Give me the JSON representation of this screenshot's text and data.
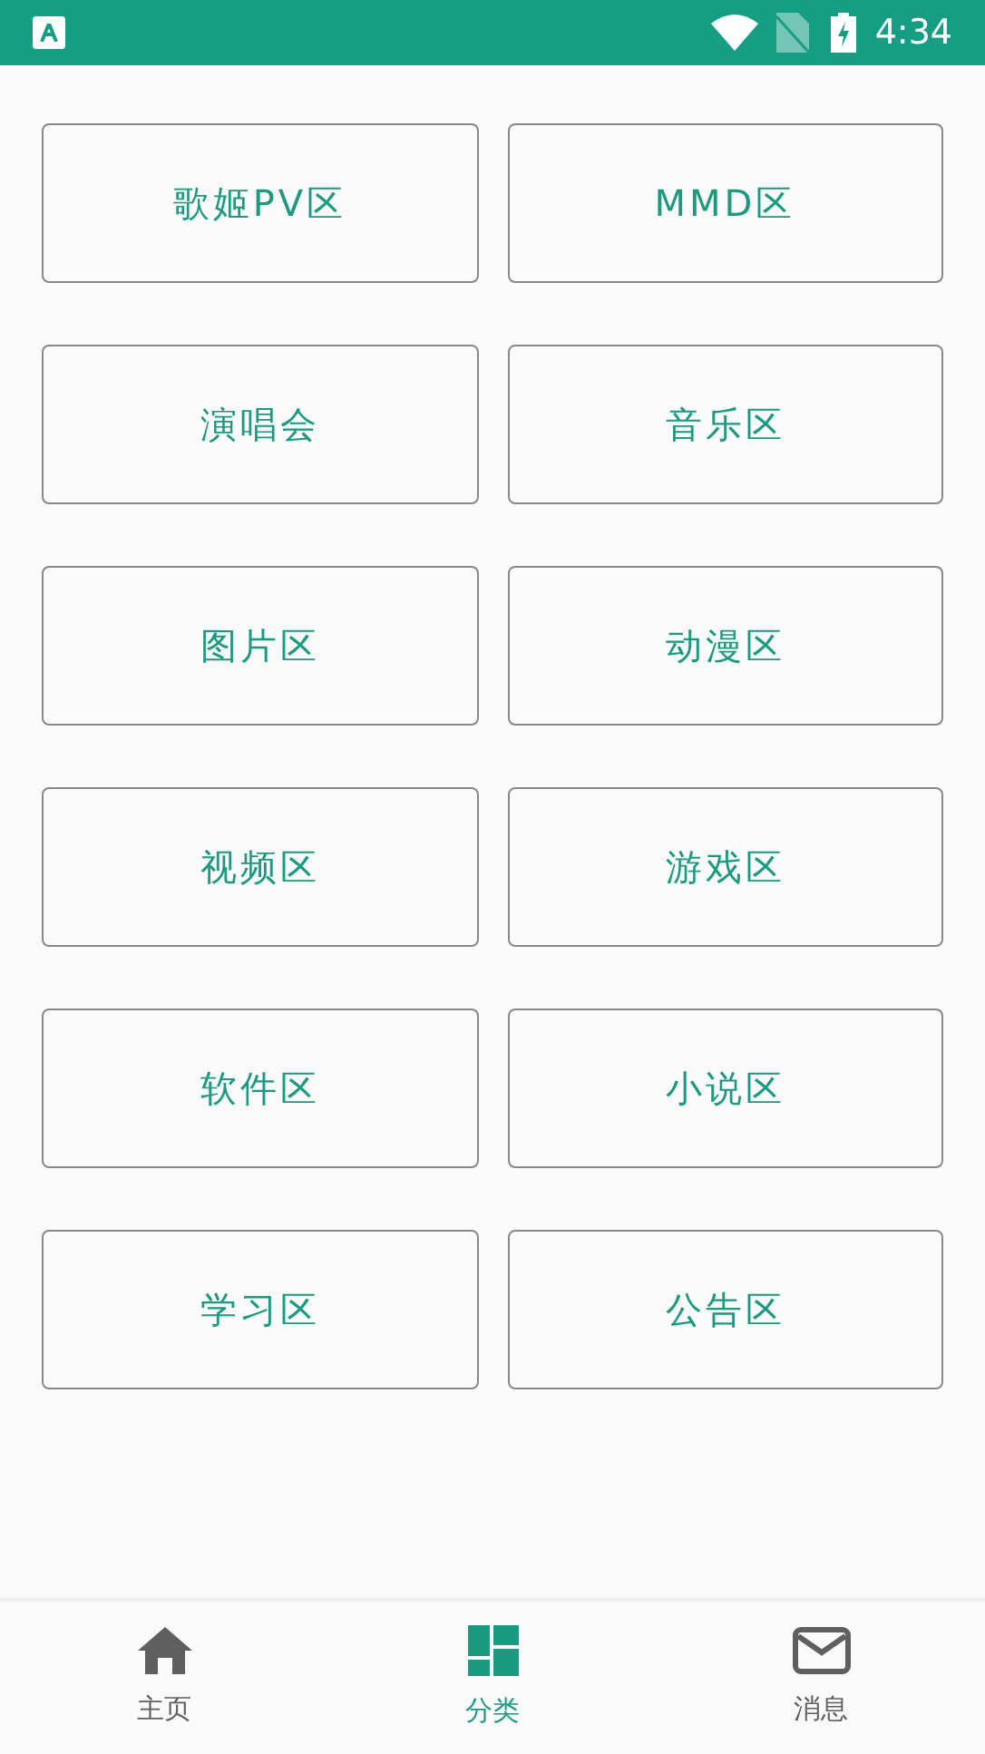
{
  "status_bar": {
    "time": "4:34"
  },
  "categories": [
    {
      "label": "歌姬PV区"
    },
    {
      "label": "MMD区"
    },
    {
      "label": "演唱会"
    },
    {
      "label": "音乐区"
    },
    {
      "label": "图片区"
    },
    {
      "label": "动漫区"
    },
    {
      "label": "视频区"
    },
    {
      "label": "游戏区"
    },
    {
      "label": "软件区"
    },
    {
      "label": "小说区"
    },
    {
      "label": "学习区"
    },
    {
      "label": "公告区"
    }
  ],
  "bottom_nav": [
    {
      "kind": "home",
      "label": "主页",
      "selected": false
    },
    {
      "kind": "category",
      "label": "分类",
      "selected": true
    },
    {
      "kind": "message",
      "label": "消息",
      "selected": false
    }
  ]
}
